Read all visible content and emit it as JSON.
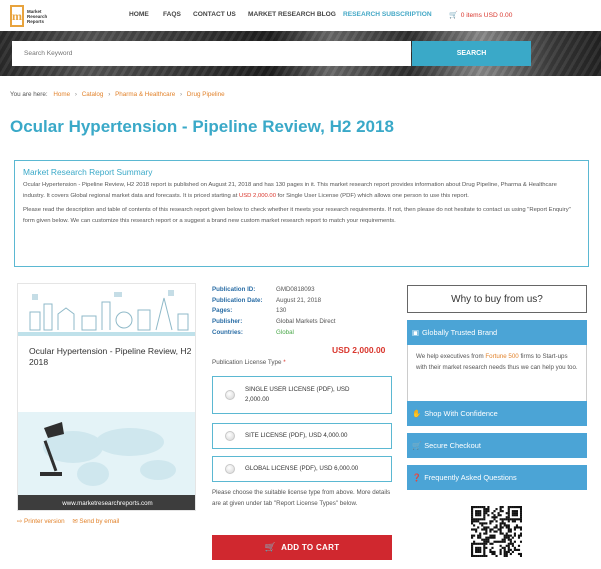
{
  "brand": {
    "logo_letter": "m",
    "logo_text": [
      "Market",
      "Research",
      "Reports"
    ]
  },
  "nav": {
    "items": [
      {
        "label": "HOME"
      },
      {
        "label": "FAQS"
      },
      {
        "label": "CONTACT US"
      },
      {
        "label": "MARKET RESEARCH BLOG"
      },
      {
        "label": "RESEARCH SUBSCRIPTION"
      }
    ],
    "cart": "0 items USD 0.00"
  },
  "search": {
    "placeholder": "Search Keyword",
    "button": "SEARCH"
  },
  "breadcrumb": {
    "prefix": "You are here:",
    "items": [
      "Home",
      "Catalog",
      "Pharma & Healthcare",
      "Drug Pipeline"
    ]
  },
  "title": "Ocular Hypertension - Pipeline Review, H2 2018",
  "summary": {
    "heading": "Market Research Report Summary",
    "p1_a": "Ocular Hypertension - Pipeline Review, H2 2018 report is published on August 21, 2018 and has 130 pages in it. This market research report provides information about Drug Pipeline, Pharma & Healthcare industry. It covers Global regional market data and forecasts. It is priced starting at ",
    "p1_price": "USD 2,000.00",
    "p1_b": " for Single User License (PDF) which allows one person to use this report.",
    "p2": "Please read the description and table of contents of this research report given below to check whether it meets your research requirements. If not, then please do not hesitate to contact us using \"Report Enquiry\" form given below. We can customize this research report or a suggest a brand new custom market research report to match your requirements."
  },
  "product_image": {
    "title": "Ocular Hypertension - Pipeline Review, H2 2018",
    "url": "www.marketresearchreports.com"
  },
  "links": {
    "printer": "Printer version",
    "email": "Send by email"
  },
  "details": [
    {
      "label": "Publication ID:",
      "value": "GMD0818093"
    },
    {
      "label": "Publication Date:",
      "value": "August 21, 2018"
    },
    {
      "label": "Pages:",
      "value": "130"
    },
    {
      "label": "Publisher:",
      "value": "Global Markets Direct"
    },
    {
      "label": "Countries:",
      "value": "Global"
    }
  ],
  "price": "USD 2,000.00",
  "license_label": "Publication License Type",
  "licenses": [
    {
      "label": "SINGLE USER LICENSE (PDF), USD 2,000.00"
    },
    {
      "label": "SITE LICENSE (PDF), USD 4,000.00"
    },
    {
      "label": "GLOBAL LICENSE (PDF), USD 6,000.00"
    }
  ],
  "note": "Please choose the suitable license type from above. More details are at given under tab \"Report License Types\" below.",
  "add_to_cart": "ADD TO CART",
  "sidebar": {
    "why": "Why to buy from us?",
    "globally": "Globally Trusted Brand",
    "desc_a": "We help executives from ",
    "desc_f500": "Fortune 500",
    "desc_b": " firms to Start-ups with their market research needs thus we can help you too.",
    "shop": "Shop With Confidence",
    "secure": "Secure Checkout",
    "faq": "Frequently Asked Questions"
  },
  "colors": {
    "accent": "#3aa9c8",
    "price": "#d9362d",
    "link": "#e2832c",
    "sidebar": "#4ba4d6",
    "cart": "#d0282f"
  }
}
